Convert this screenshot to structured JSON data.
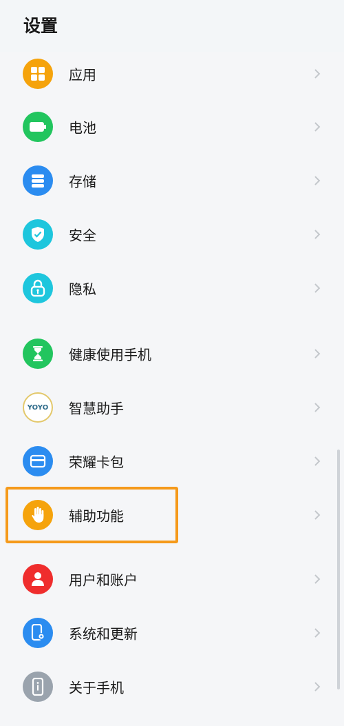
{
  "header": {
    "title": "设置"
  },
  "items": [
    {
      "label": "应用",
      "icon": "apps-grid-icon",
      "color": "#f5a30c"
    },
    {
      "label": "电池",
      "icon": "battery-icon",
      "color": "#22c55e"
    },
    {
      "label": "存储",
      "icon": "storage-icon",
      "color": "#2b8cf0"
    },
    {
      "label": "安全",
      "icon": "shield-check-icon",
      "color": "#1ec6dd"
    },
    {
      "label": "隐私",
      "icon": "privacy-lock-icon",
      "color": "#1ec6dd"
    },
    {
      "label": "健康使用手机",
      "icon": "hourglass-icon",
      "color": "#22c55e"
    },
    {
      "label": "智慧助手",
      "icon": "yoyo-icon",
      "icon_text": "YOYO",
      "color": "#ffffff"
    },
    {
      "label": "荣耀卡包",
      "icon": "wallet-card-icon",
      "color": "#2b8cf0"
    },
    {
      "label": "辅助功能",
      "icon": "hand-icon",
      "color": "#f5a30c",
      "highlighted": true
    },
    {
      "label": "用户和账户",
      "icon": "user-icon",
      "color": "#ef2d2d"
    },
    {
      "label": "系统和更新",
      "icon": "phone-settings-icon",
      "color": "#2b8cf0"
    },
    {
      "label": "关于手机",
      "icon": "phone-info-icon",
      "color": "#9aa3ad"
    }
  ]
}
